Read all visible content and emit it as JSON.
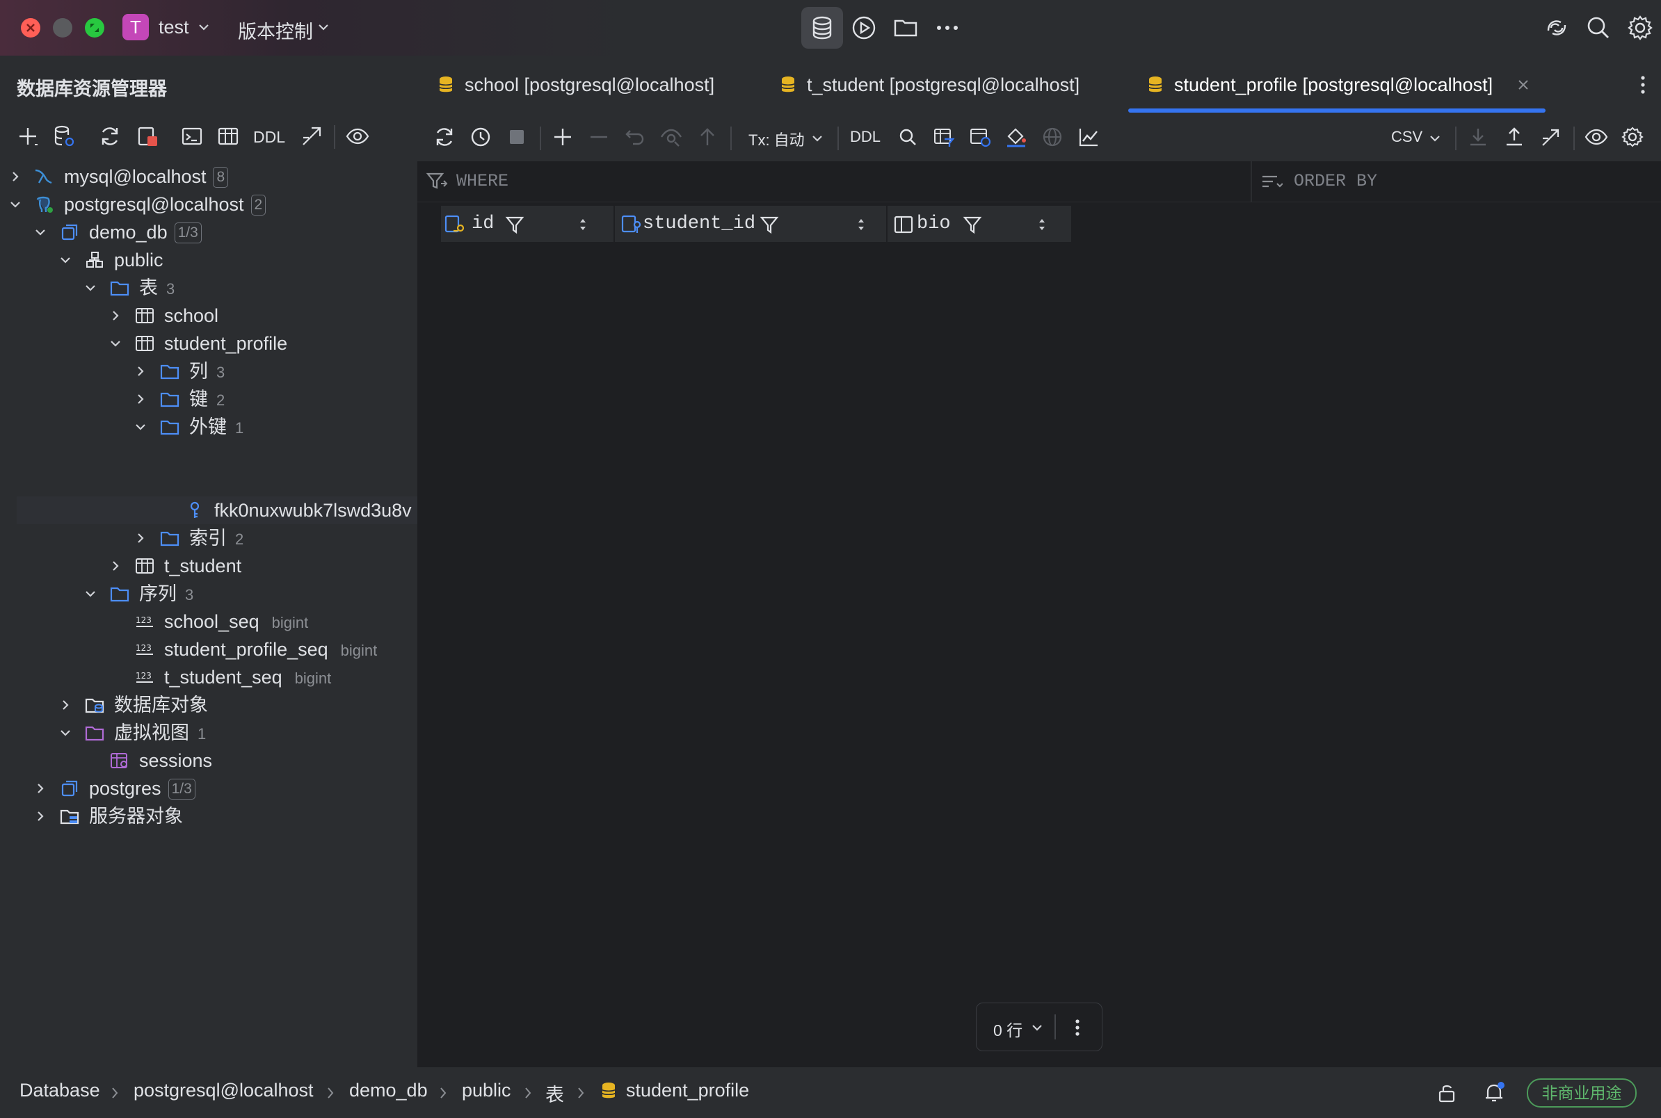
{
  "titlebar": {
    "project_initial": "T",
    "project_name": "test",
    "vcs_label": "版本控制"
  },
  "sidebar": {
    "title": "数据库资源管理器",
    "toolbar": {
      "ddl_label": "DDL"
    },
    "tree": [
      {
        "label": "mysql@localhost",
        "box": "8",
        "icon": "mysql-icon"
      },
      {
        "label": "postgresql@localhost",
        "box": "2",
        "icon": "postgresql-icon"
      },
      {
        "label": "demo_db",
        "box": "1/3",
        "icon": "database-icon"
      },
      {
        "label": "public",
        "icon": "schema-icon"
      },
      {
        "label": "表",
        "count": "3",
        "icon": "folder-icon"
      },
      {
        "label": "school",
        "icon": "table-icon"
      },
      {
        "label": "student_profile",
        "icon": "table-icon"
      },
      {
        "label": "列",
        "count": "3",
        "icon": "folder-icon"
      },
      {
        "label": "键",
        "count": "2",
        "icon": "folder-icon"
      },
      {
        "label": "外键",
        "count": "1",
        "icon": "folder-icon"
      },
      {
        "label": "fkk0nuxwubk7lswd3u8v",
        "icon": "foreign-key-icon"
      },
      {
        "label": "索引",
        "count": "2",
        "icon": "folder-icon"
      },
      {
        "label": "t_student",
        "icon": "table-icon"
      },
      {
        "label": "序列",
        "count": "3",
        "icon": "folder-icon"
      },
      {
        "label": "school_seq",
        "type": "bigint",
        "icon": "sequence-icon"
      },
      {
        "label": "student_profile_seq",
        "type": "bigint",
        "icon": "sequence-icon"
      },
      {
        "label": "t_student_seq",
        "type": "bigint",
        "icon": "sequence-icon"
      },
      {
        "label": "数据库对象",
        "icon": "db-objects-icon"
      },
      {
        "label": "虚拟视图",
        "count": "1",
        "icon": "folder-icon"
      },
      {
        "label": "sessions",
        "icon": "view-icon"
      },
      {
        "label": "postgres",
        "box": "1/3",
        "icon": "database-icon"
      },
      {
        "label": "服务器对象",
        "icon": "server-objects-icon"
      }
    ]
  },
  "tabs": [
    {
      "label": "school [postgresql@localhost]"
    },
    {
      "label": "t_student [postgresql@localhost]"
    },
    {
      "label": "student_profile [postgresql@localhost]",
      "active": true
    }
  ],
  "toolbar": {
    "tx_label": "Tx: 自动",
    "ddl_label": "DDL",
    "export_format": "CSV"
  },
  "filter": {
    "where_label": "WHERE",
    "order_by_label": "ORDER BY"
  },
  "grid": {
    "columns": [
      {
        "name": "id",
        "icon": "primary-key-column-icon"
      },
      {
        "name": "student_id",
        "icon": "foreign-key-column-icon"
      },
      {
        "name": "bio",
        "icon": "column-icon"
      }
    ],
    "rows": [],
    "row_count_label": "0 行"
  },
  "statusbar": {
    "breadcrumbs": [
      "Database",
      "postgresql@localhost",
      "demo_db",
      "public",
      "表",
      "student_profile"
    ],
    "license_label": "非商业用途"
  },
  "colors": {
    "accent": "#3574f0",
    "background": "#1e1f22",
    "panel": "#2b2d30",
    "license_green": "#5fb86d",
    "db_yellow": "#e6b422"
  }
}
